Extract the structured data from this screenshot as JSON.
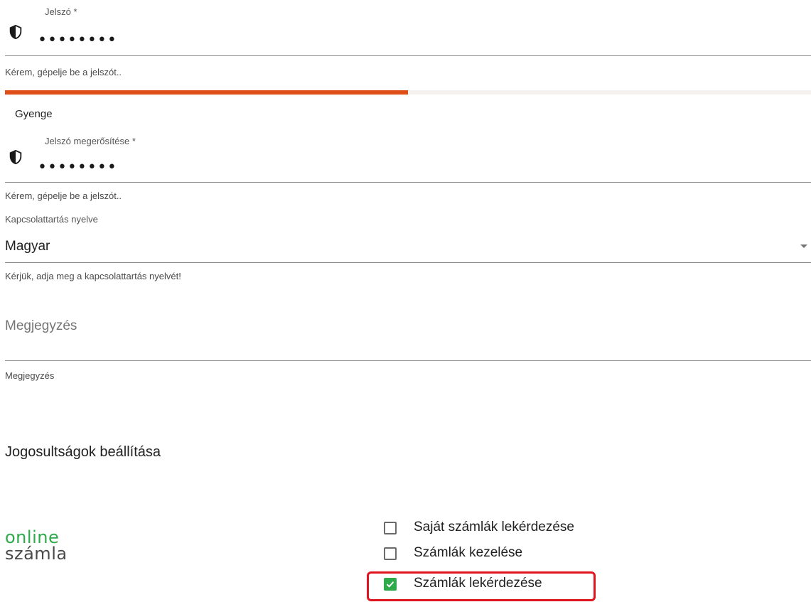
{
  "password": {
    "label": "Jelszó *",
    "masked_value": "••••••••",
    "hint": "Kérem, gépelje be a jelszót..",
    "strength": {
      "label": "Gyenge",
      "fill_fraction": 0.5,
      "color": "#e04e18"
    },
    "icon": "shield-icon"
  },
  "password_confirm": {
    "label": "Jelszó megerősítése *",
    "masked_value": "••••••••",
    "hint": "Kérem, gépelje be a jelszót..",
    "icon": "shield-icon"
  },
  "language": {
    "label": "Kapcsolattartás nyelve",
    "value": "Magyar",
    "hint": "Kérjük, adja meg a kapcsolattartás nyelvét!"
  },
  "note": {
    "placeholder": "Megjegyzés",
    "hint": "Megjegyzés"
  },
  "permissions": {
    "title": "Jogosultságok beállítása",
    "logo": {
      "line1": "online",
      "line2": "számla"
    },
    "options": [
      {
        "label": "Saját számlák lekérdezése",
        "checked": false
      },
      {
        "label": "Számlák kezelése",
        "checked": false
      },
      {
        "label": "Számlák lekérdezése",
        "checked": true
      }
    ]
  },
  "colors": {
    "accent_green": "#2eaa4a",
    "highlight_red": "#e0141e",
    "strength_orange": "#e04e18"
  }
}
